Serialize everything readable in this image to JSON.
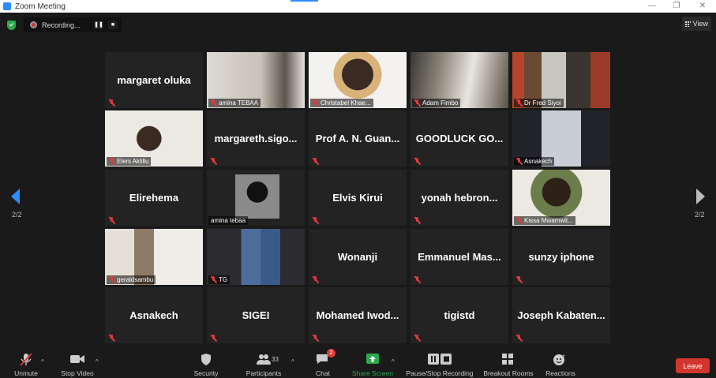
{
  "window": {
    "title": "Zoom Meeting",
    "minimize": "—",
    "restore": "❐",
    "close": "✕"
  },
  "topbar": {
    "recording_label": "Recording...",
    "pause": "❚❚",
    "stop": "■",
    "view_label": "View"
  },
  "pager": {
    "left": "2/2",
    "right": "2/2"
  },
  "participants": [
    {
      "name": "margaret oluka",
      "video": false
    },
    {
      "name": "amina TEBAA",
      "video": true
    },
    {
      "name": "Christabel Khae...",
      "video": true
    },
    {
      "name": "Adam Fimbo",
      "video": true
    },
    {
      "name": "Dr Fred Siyoi",
      "video": true
    },
    {
      "name": "Eleni Aklillu",
      "video": true
    },
    {
      "name": "margareth.sigo...",
      "video": false
    },
    {
      "name": "Prof A. N. Guan...",
      "video": false
    },
    {
      "name": "GOODLUCK GO...",
      "video": false
    },
    {
      "name": "Asnakech",
      "video": true
    },
    {
      "name": "Elirehema",
      "video": false
    },
    {
      "name": "amina tebaa",
      "video": true,
      "active_speaker": true
    },
    {
      "name": "Elvis Kirui",
      "video": false
    },
    {
      "name": "yonah hebron...",
      "video": false
    },
    {
      "name": "Kissa Mwamwit...",
      "video": true
    },
    {
      "name": "geraldsambu",
      "video": true
    },
    {
      "name": "TG",
      "video": true
    },
    {
      "name": "Wonanji",
      "video": false
    },
    {
      "name": "Emmanuel Mas...",
      "video": false
    },
    {
      "name": "sunzy iphone",
      "video": false
    },
    {
      "name": "Asnakech",
      "video": false
    },
    {
      "name": "SIGEI",
      "video": false
    },
    {
      "name": "Mohamed Iwod...",
      "video": false
    },
    {
      "name": "tigistd",
      "video": false
    },
    {
      "name": "Joseph Kabaten...",
      "video": false
    }
  ],
  "toolbar": {
    "unmute": "Unmute",
    "stop_video": "Stop Video",
    "security": "Security",
    "participants": "Participants",
    "participants_count": "33",
    "chat": "Chat",
    "chat_badge": "2",
    "share_screen": "Share Screen",
    "pause_stop_recording": "Pause/Stop Recording",
    "breakout_rooms": "Breakout Rooms",
    "reactions": "Reactions",
    "leave": "Leave",
    "caret": "^"
  },
  "colors": {
    "accent": "#2d8cff",
    "share": "#2ca94d",
    "leave": "#d2352e",
    "muted": "#e03b3b",
    "speaker_outline": "#d8df4e"
  }
}
